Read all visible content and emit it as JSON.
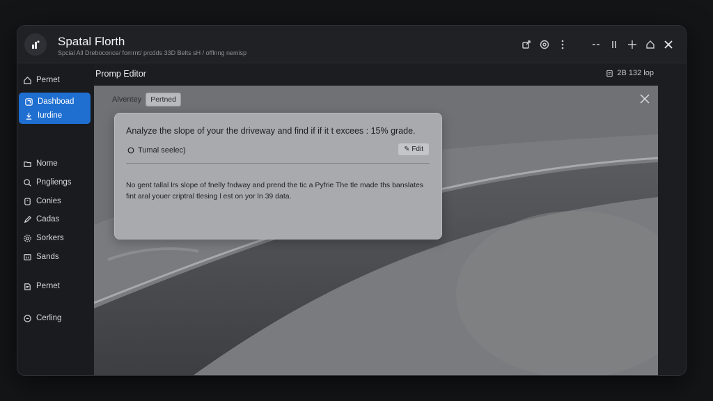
{
  "app": {
    "title": "Spatal Florth",
    "subtitle": "Spcial All Dreboconce/ fomrnt/ prcdds 33D Belts sH / offlnng nemisp"
  },
  "titlebar_icons": [
    "share-icon",
    "settings-icon",
    "more-vertical-icon",
    "minimize-icon",
    "pause-icon",
    "move-icon",
    "home-icon",
    "close-icon"
  ],
  "sidebar": {
    "items": [
      {
        "label": "Pernet",
        "icon": "home-icon"
      },
      {
        "label": "Dashboad",
        "icon": "dashboard-icon",
        "active": true
      },
      {
        "label": "Iurdine",
        "icon": "download-icon",
        "active": true
      },
      {
        "label": "Nome",
        "icon": "folder-icon"
      },
      {
        "label": "Pngliengs",
        "icon": "search-icon"
      },
      {
        "label": "Conies",
        "icon": "copy-icon"
      },
      {
        "label": "Cadas",
        "icon": "edit-icon"
      },
      {
        "label": "Sorkers",
        "icon": "gear-icon"
      },
      {
        "label": "Sands",
        "icon": "grid-icon"
      },
      {
        "label": "Pernet",
        "icon": "layers-icon"
      },
      {
        "label": "Cerling",
        "icon": "circle-icon"
      }
    ]
  },
  "editor": {
    "title": "Promp Editor",
    "meta": "2B 132 lop"
  },
  "tabs": {
    "label": "Alventey",
    "chip": "Pertned"
  },
  "card": {
    "heading": "Analyze the slope of your the driveway and find if if it t excees : 15% grade.",
    "option": "Tumal seelec)",
    "edit_label": "Fdit",
    "body": "No gent tallal lrs slope of fnelly fndway and prend the tic a Pyfrie The tle made ths banslates fint aral youer criptral tlesing l est on yor ln 39 data."
  },
  "colors": {
    "accent": "#1f6fd1",
    "workspace": "#6e6f72",
    "card": "#a9aaad"
  }
}
